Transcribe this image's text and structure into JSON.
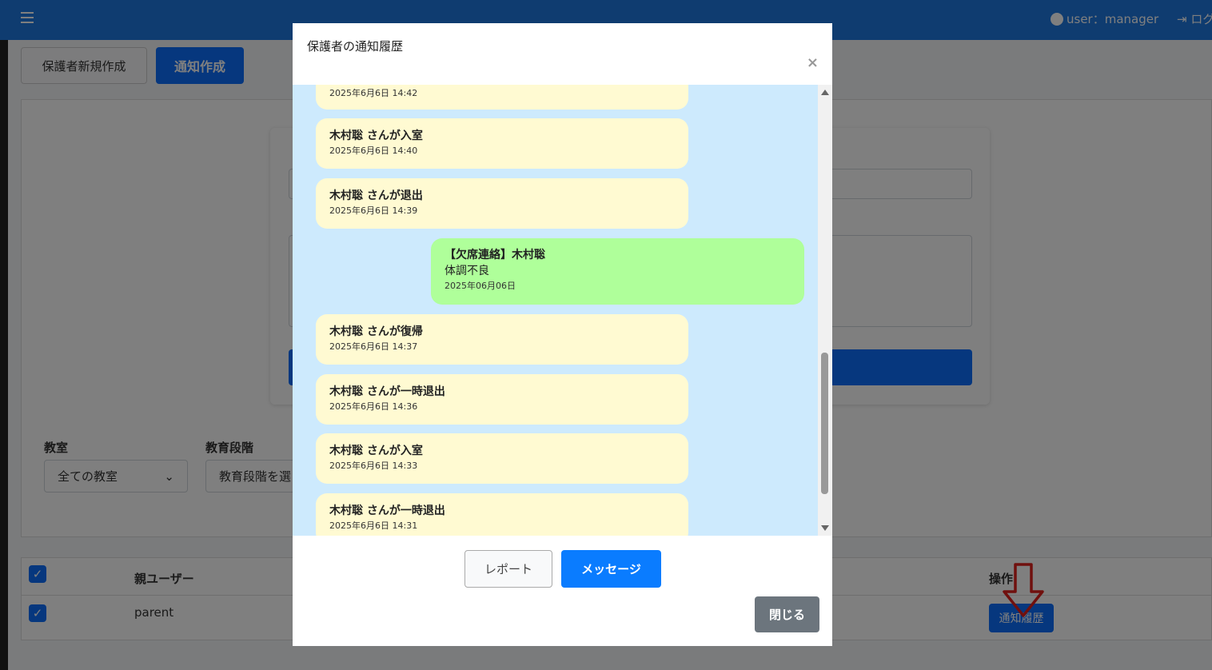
{
  "header": {
    "user_label": "user：manager",
    "logout_label": "ログ"
  },
  "toolbar": {
    "new_parent_label": "保護者新規作成",
    "create_notice_label": "通知作成"
  },
  "filters": {
    "classroom_label": "教室",
    "classroom_value": "全ての教室",
    "grade_label": "教育段階",
    "grade_value": "教育段階を選"
  },
  "table": {
    "col_parent": "親ユーザー",
    "col_actions": "操作",
    "rows": [
      {
        "parent": "parent",
        "history_label": "通知履歴"
      }
    ]
  },
  "modal": {
    "title": "保護者の通知履歴",
    "close_x": "×",
    "messages": [
      {
        "kind": "system",
        "title": "",
        "time": "2025年6月6日 14:42"
      },
      {
        "kind": "system",
        "title": "木村聡 さんが入室",
        "time": "2025年6月6日 14:40"
      },
      {
        "kind": "system",
        "title": "木村聡 さんが退出",
        "time": "2025年6月6日 14:39"
      },
      {
        "kind": "absence",
        "title": "【欠席連絡】木村聡",
        "body": "体調不良",
        "time": "2025年06月06日"
      },
      {
        "kind": "system",
        "title": "木村聡 さんが復帰",
        "time": "2025年6月6日 14:37"
      },
      {
        "kind": "system",
        "title": "木村聡 さんが一時退出",
        "time": "2025年6月6日 14:36"
      },
      {
        "kind": "system",
        "title": "木村聡 さんが入室",
        "time": "2025年6月6日 14:33"
      },
      {
        "kind": "system",
        "title": "木村聡 さんが一時退出",
        "time": "2025年6月6日 14:31"
      }
    ],
    "report_label": "レポート",
    "message_label": "メッセージ",
    "close_label": "閉じる"
  },
  "icons": {
    "menu": "hamburger-icon",
    "user": "user-circle-icon",
    "logout": "logout-icon",
    "checkbox": "check-icon",
    "annotation": "red-down-arrow-icon"
  },
  "colors": {
    "primary": "#0d6efd",
    "system_bubble": "#fffad2",
    "absence_bubble": "#afff9a",
    "chat_background": "#cdeafd"
  }
}
